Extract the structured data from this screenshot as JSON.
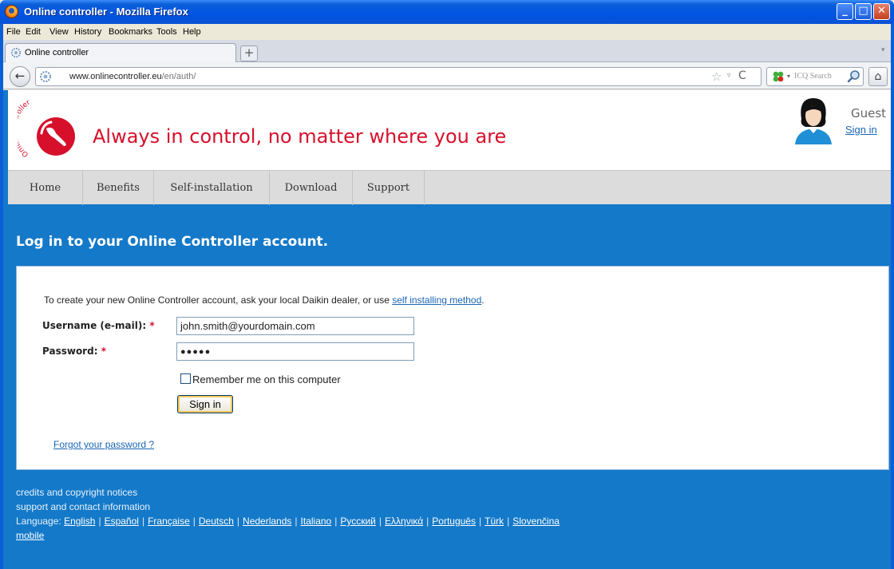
{
  "window": {
    "title": "Online controller - Mozilla Firefox",
    "min": "_",
    "max": "□",
    "close": "✕"
  },
  "menu": [
    "File",
    "Edit",
    "View",
    "History",
    "Bookmarks",
    "Tools",
    "Help"
  ],
  "tab": {
    "label": "Online controller",
    "new_tab": "+",
    "list": "▾"
  },
  "nav": {
    "back": "←",
    "url_host": "www.onlinecontroller.eu",
    "url_path": "/en/auth/",
    "star": "☆",
    "dropdown": "▿",
    "reload": "C",
    "search_placeholder": "ICQ Search",
    "search_dropdown": "▾",
    "home": "⌂"
  },
  "header": {
    "tagline": "Always in control, no matter where you are",
    "logo_text": "Online controller",
    "user": "Guest",
    "signin_link": "Sign in"
  },
  "site_nav": [
    "Home",
    "Benefits",
    "Self-installation",
    "Download",
    "Support"
  ],
  "login": {
    "heading": "Log in to your Online Controller account.",
    "intro": "To create your new Online Controller account, ask your local Daikin dealer, or use ",
    "intro_link": "self installing method",
    "intro_end": ".",
    "username_label": "Username (e-mail):",
    "password_label": "Password:",
    "required_mark": "*",
    "username_value": "john.smith@yourdomain.com",
    "password_value": "●●●●●",
    "remember_label": "Remember me on this computer",
    "signin_button": "Sign in",
    "forgot_link": "Forgot your password ?"
  },
  "footer": {
    "credits": "credits and copyright notices",
    "support": "support and contact information",
    "language_label": "Language:",
    "languages": [
      "English",
      "Español",
      "Française",
      "Deutsch",
      "Nederlands",
      "Italiano",
      "Русский",
      "Ελληνικά",
      "Português",
      "Türk",
      "Slovenčina"
    ],
    "mobile": "mobile"
  },
  "colors": {
    "brand_red": "#d6102b",
    "page_blue": "#1479c8",
    "link": "#1a66b6"
  }
}
